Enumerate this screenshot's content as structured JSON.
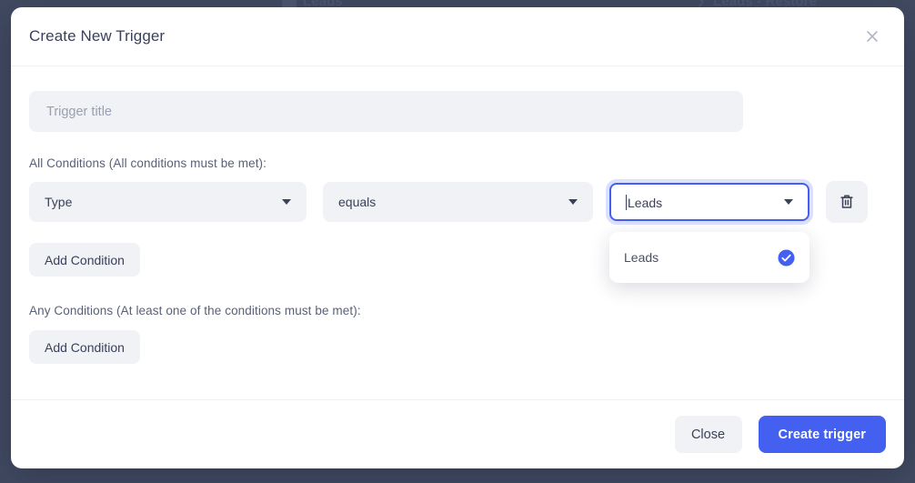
{
  "background": {
    "crumb_left": "Leads",
    "crumb_right": "Leads - Restore",
    "overlay_color": "#414a61"
  },
  "modal": {
    "title": "Create New Trigger",
    "close_icon": "close-icon",
    "trigger_title": {
      "value": "",
      "placeholder": "Trigger title"
    },
    "all_conditions": {
      "label": "All Conditions (All conditions must be met):",
      "condition": {
        "field": "Type",
        "operator": "equals",
        "value": "Leads",
        "delete_icon": "trash-icon"
      },
      "dropdown": {
        "options": [
          {
            "label": "Leads",
            "selected": true
          }
        ]
      },
      "add_condition_label": "Add Condition"
    },
    "any_conditions": {
      "label": "Any Conditions (At least one of the conditions must be met):",
      "add_condition_label": "Add Condition"
    },
    "footer": {
      "close_label": "Close",
      "create_label": "Create trigger"
    }
  },
  "colors": {
    "accent": "#4460f1",
    "focus_ring": "#5870f5",
    "field_bg": "#f1f2f6",
    "text": "#3a4159",
    "backdrop": "#414a61"
  }
}
